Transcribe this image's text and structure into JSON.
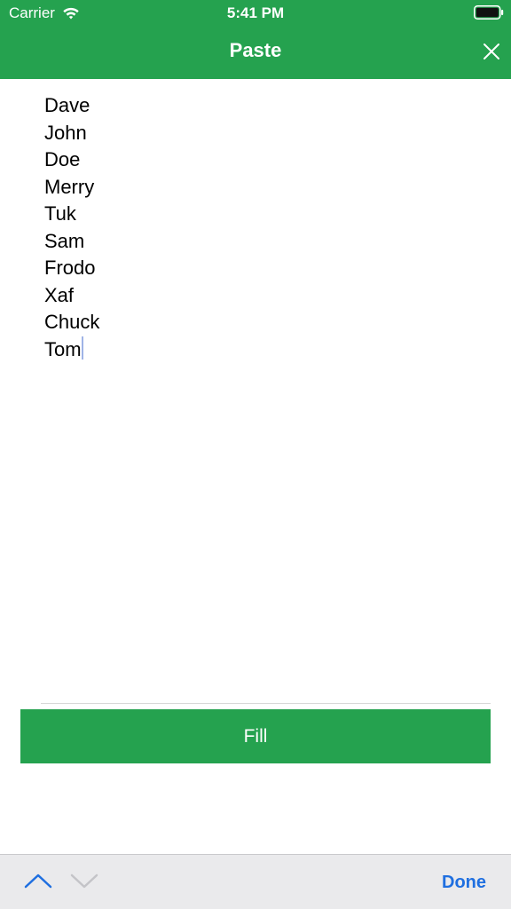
{
  "status_bar": {
    "carrier": "Carrier",
    "time": "5:41 PM",
    "wifi_icon": "wifi-icon",
    "battery_icon": "battery-icon"
  },
  "nav": {
    "title": "Paste",
    "close_icon": "close-icon"
  },
  "text_area": {
    "lines": [
      "Dave",
      "John",
      "Doe",
      "Merry",
      "Tuk",
      "Sam",
      "Frodo",
      "Xaf",
      "Chuck",
      "Tom"
    ]
  },
  "fill_button": {
    "label": "Fill"
  },
  "toolbar": {
    "prev_icon": "chevron-up-icon",
    "next_icon": "chevron-down-icon",
    "done_label": "Done"
  },
  "colors": {
    "brand_green": "#25a24f",
    "done_blue": "#1f6fe0",
    "toolbar_bg": "#eaeaec"
  }
}
